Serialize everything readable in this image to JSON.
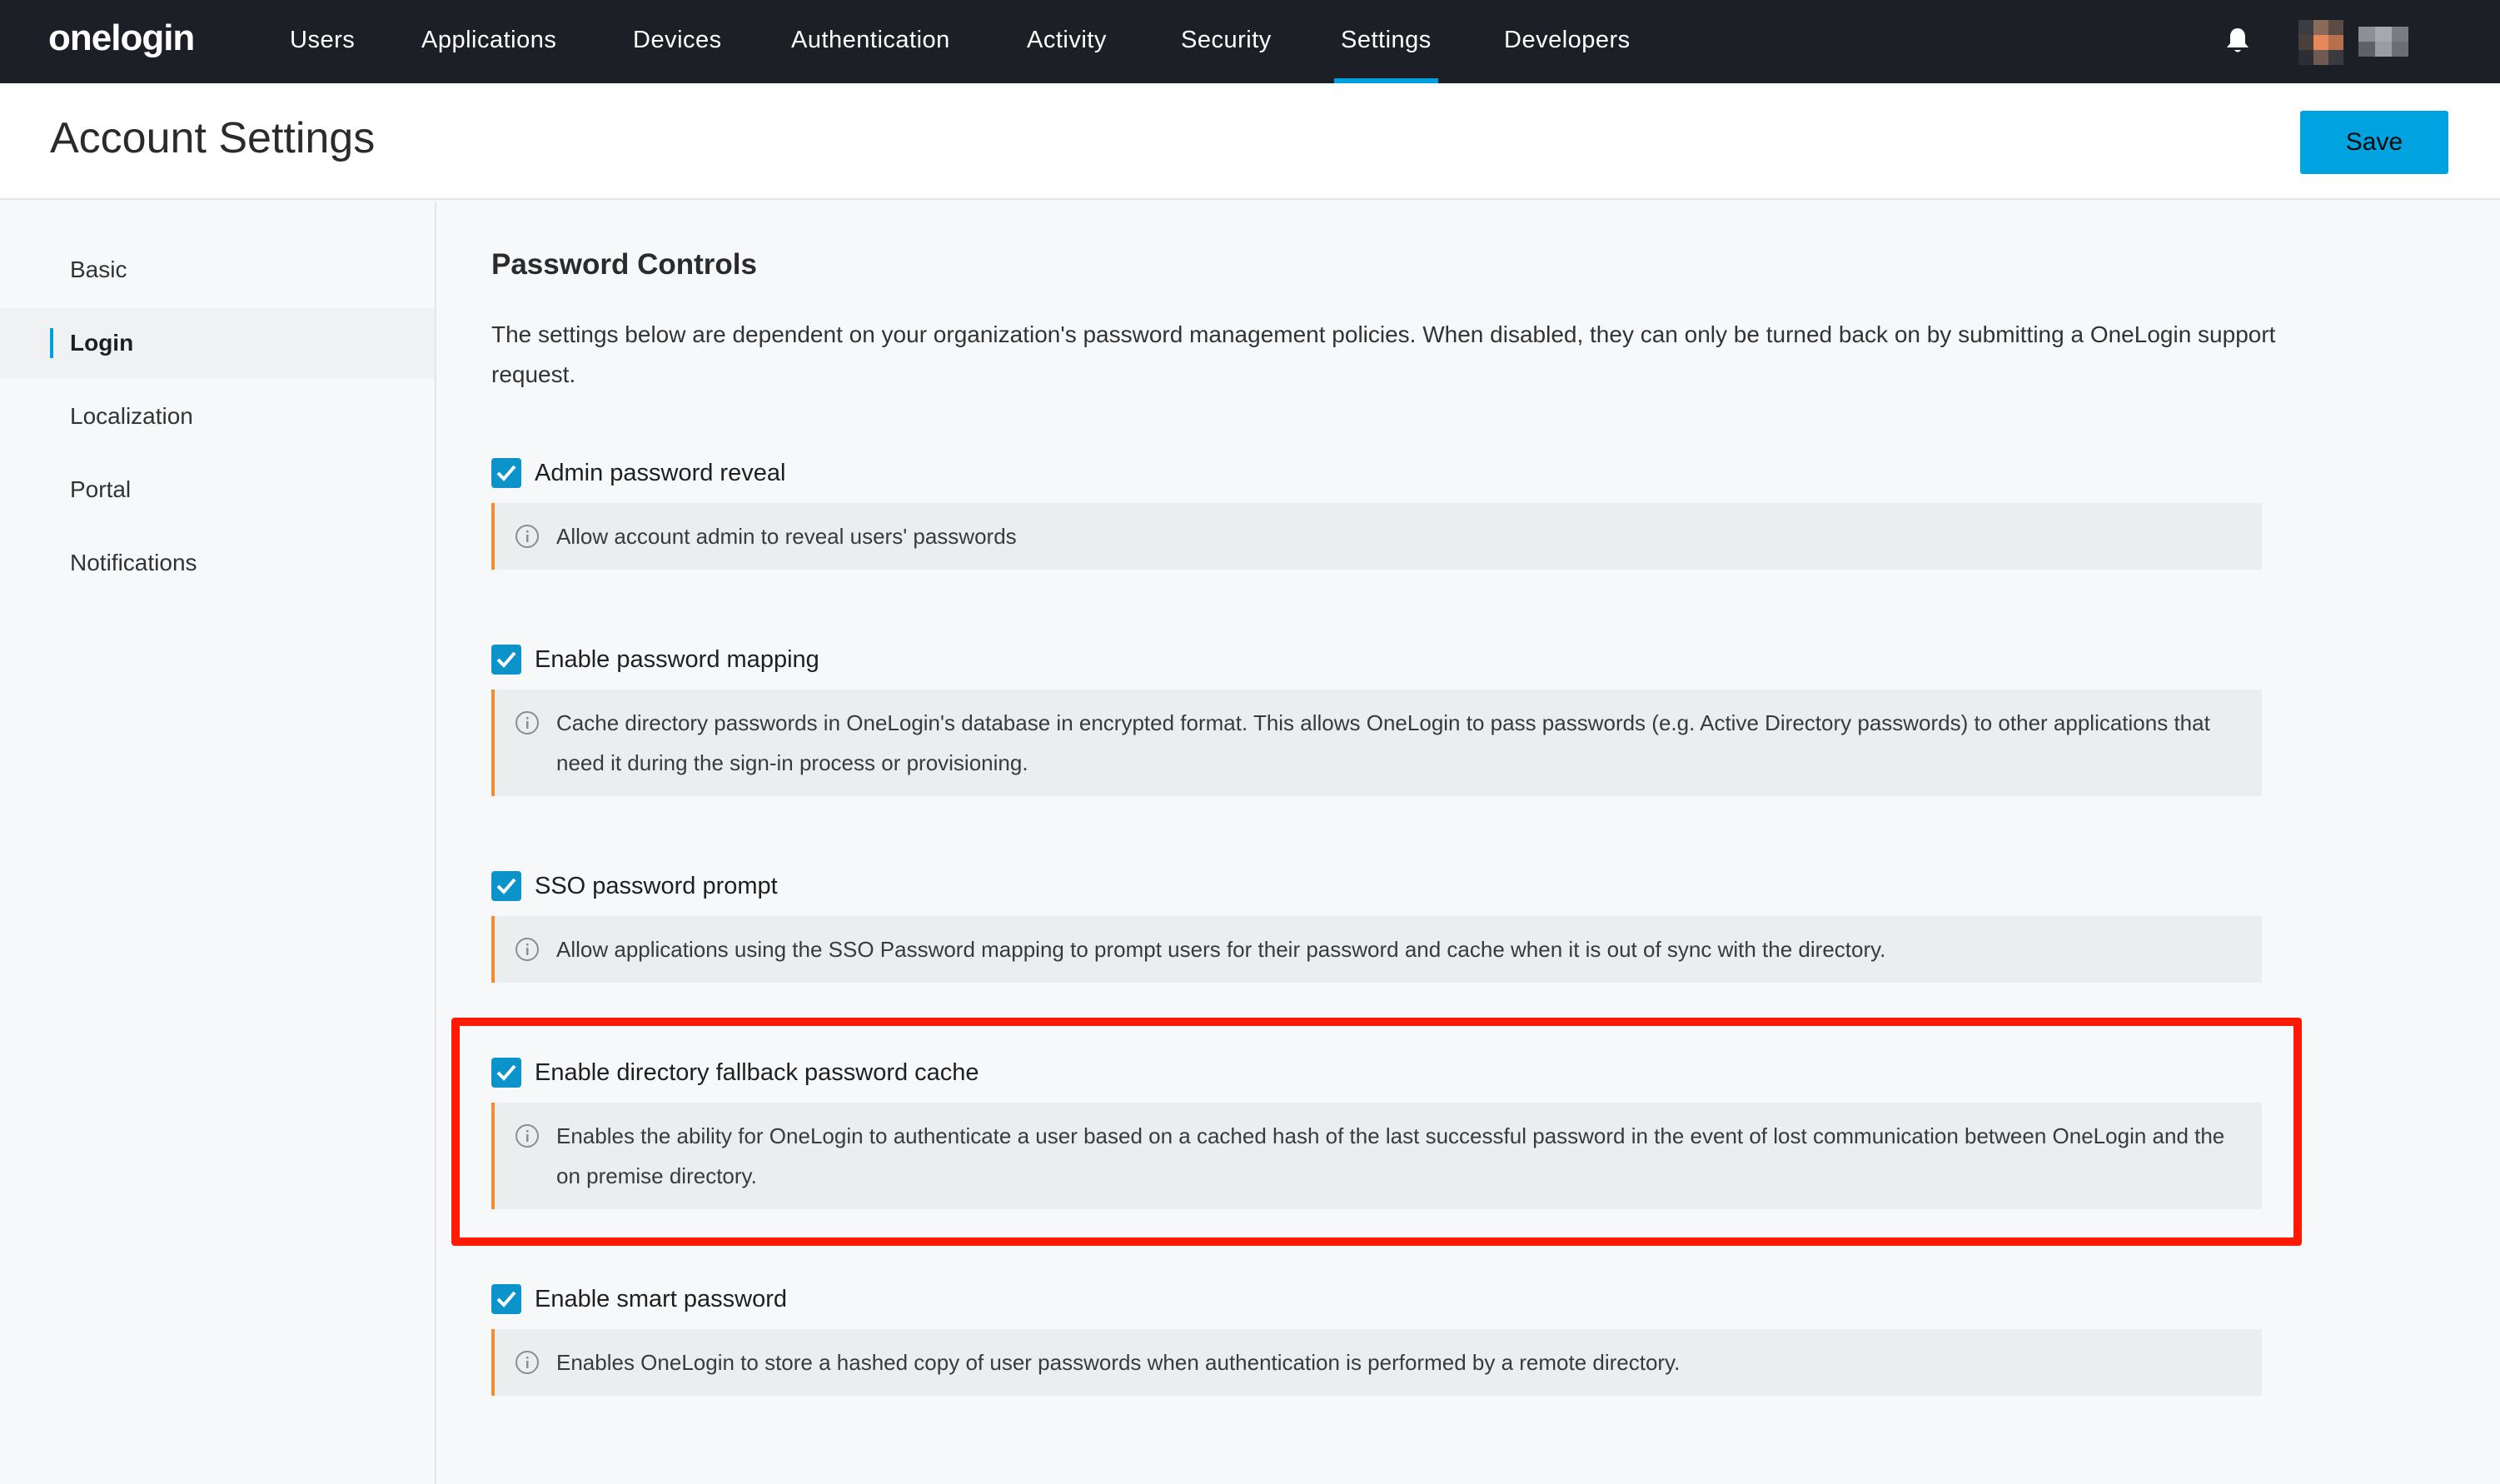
{
  "nav": {
    "logo": "onelogin",
    "items": [
      "Users",
      "Applications",
      "Devices",
      "Authentication",
      "Activity",
      "Security",
      "Settings",
      "Developers"
    ],
    "active": "Settings"
  },
  "header": {
    "title": "Account Settings",
    "save_label": "Save"
  },
  "sidebar": {
    "items": [
      {
        "label": "Basic"
      },
      {
        "label": "Login"
      },
      {
        "label": "Localization"
      },
      {
        "label": "Portal"
      },
      {
        "label": "Notifications"
      }
    ],
    "active": "Login"
  },
  "section": {
    "title": "Password Controls",
    "description": "The settings below are dependent on your organization's password management policies. When disabled, they can only be turned back on by submitting a OneLogin support request."
  },
  "settings": [
    {
      "label": "Admin password reveal",
      "checked": true,
      "info": "Allow account admin to reveal users' passwords"
    },
    {
      "label": "Enable password mapping",
      "checked": true,
      "info": "Cache directory passwords in OneLogin's database in encrypted format. This allows OneLogin to pass passwords (e.g. Active Directory passwords) to other applications that need it during the sign-in process or provisioning."
    },
    {
      "label": "SSO password prompt",
      "checked": true,
      "info": "Allow applications using the SSO Password mapping to prompt users for their password and cache when it is out of sync with the directory."
    },
    {
      "label": "Enable directory fallback password cache",
      "checked": true,
      "info": "Enables the ability for OneLogin to authenticate a user based on a cached hash of the last successful password in the event of lost communication between OneLogin and the on premise directory."
    },
    {
      "label": "Enable smart password",
      "checked": true,
      "info": "Enables OneLogin to store a hashed copy of user passwords when authentication is performed by a remote directory."
    }
  ],
  "colors": {
    "nav_bg": "#1c1f26",
    "accent": "#00a0df",
    "checkbox": "#0c93c9",
    "info_border": "#f08c32",
    "highlight": "#ff1a05"
  }
}
